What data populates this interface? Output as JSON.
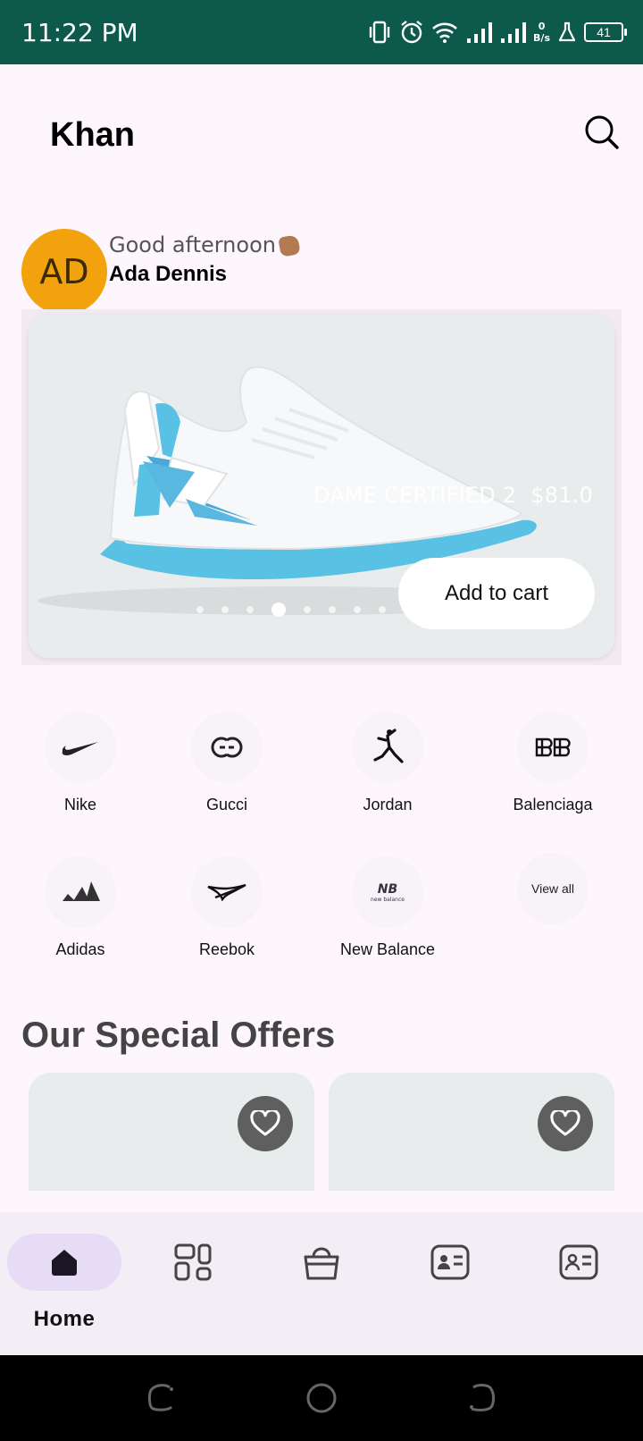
{
  "status_bar": {
    "time": "11:22 PM",
    "net_speed_value": "0",
    "net_speed_unit": "B/s",
    "battery": "41",
    "icons": [
      "vibrate-icon",
      "alarm-icon",
      "wifi-icon",
      "signal-icon",
      "signal-icon",
      "flask-icon",
      "battery-icon"
    ]
  },
  "appbar": {
    "title": "Khan",
    "search_icon": "search-icon"
  },
  "greeting": {
    "avatar_initials": "AD",
    "avatar_color": "#f1a20d",
    "message": "Good afternoon",
    "emoji_icon": "waving-hand-icon",
    "name": "Ada Dennis"
  },
  "banner": {
    "product_name": "DAME CERTIFIED 2",
    "price": "$81.0",
    "cta_label": "Add to cart",
    "dots_total": 8,
    "active_dot": 3
  },
  "brands": [
    {
      "label": "Nike",
      "icon": "nike-logo-icon"
    },
    {
      "label": "Gucci",
      "icon": "gucci-logo-icon"
    },
    {
      "label": "Jordan",
      "icon": "jordan-logo-icon"
    },
    {
      "label": "Balenciaga",
      "icon": "balenciaga-logo-icon"
    },
    {
      "label": "Adidas",
      "icon": "adidas-logo-icon"
    },
    {
      "label": "Reebok",
      "icon": "reebok-logo-icon"
    },
    {
      "label": "New Balance",
      "icon": "new-balance-logo-icon",
      "logo_text": "new balance"
    }
  ],
  "view_all": "View all",
  "offers": {
    "title": "Our Special Offers",
    "card_count": 2,
    "favorite_icon": "heart-icon"
  },
  "bottom_nav": {
    "items": [
      {
        "label": "Home",
        "icon": "home-icon",
        "active": true
      },
      {
        "label": "",
        "icon": "grid-icon",
        "active": false
      },
      {
        "label": "",
        "icon": "shopping-bag-icon",
        "active": false
      },
      {
        "label": "",
        "icon": "contact-card-icon",
        "active": false
      },
      {
        "label": "",
        "icon": "profile-card-icon",
        "active": false
      }
    ]
  },
  "accent_color": "#0d5a4c"
}
